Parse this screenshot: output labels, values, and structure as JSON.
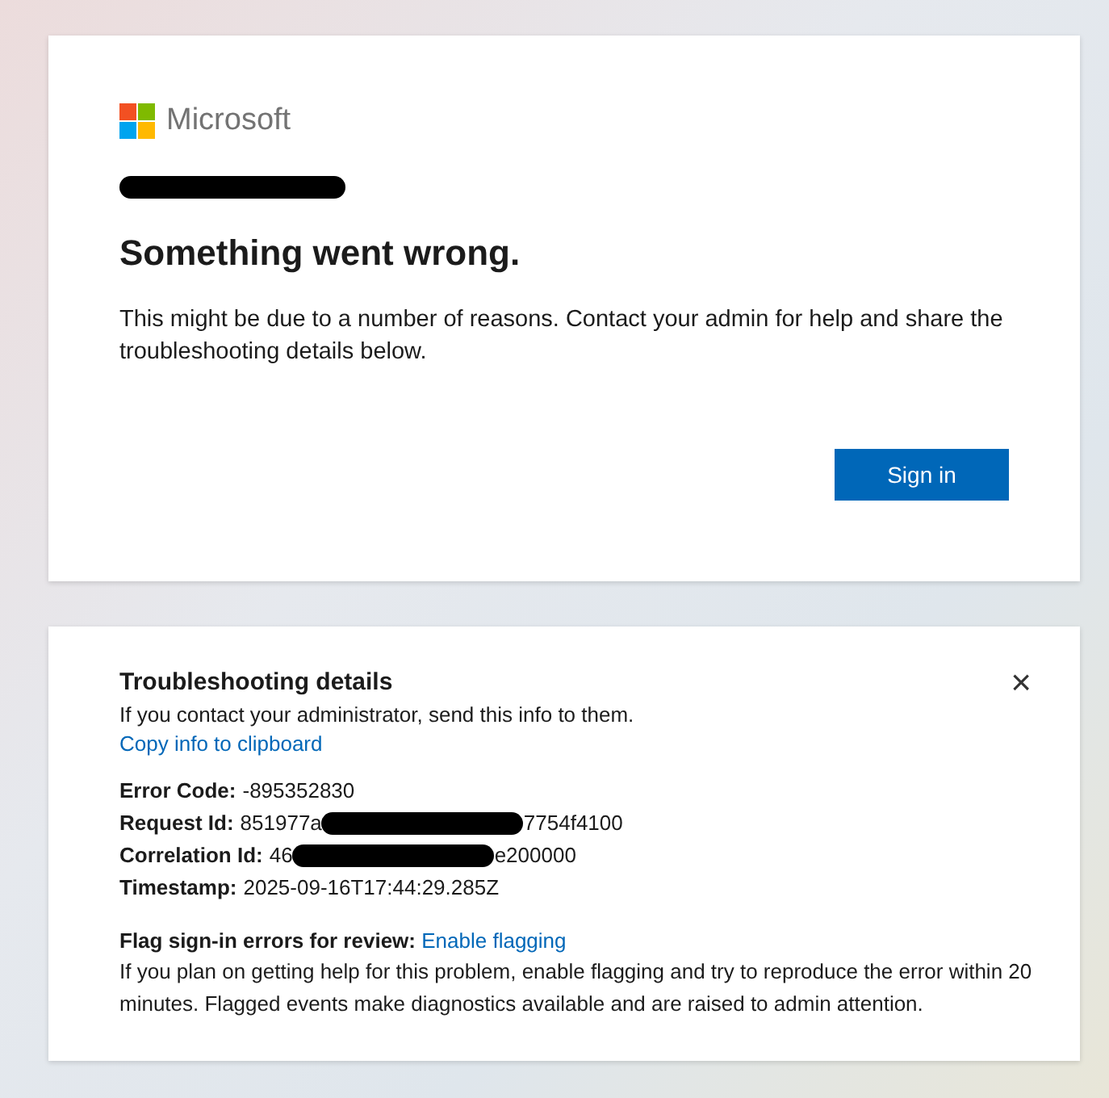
{
  "signin_card": {
    "logo": {
      "wordmark": "Microsoft"
    },
    "account": {
      "redacted": true
    },
    "title": "Something went wrong.",
    "message": "This might be due to a number of reasons. Contact your admin for help and share the troubleshooting details below.",
    "button": "Sign in"
  },
  "troubleshooting": {
    "title": "Troubleshooting details",
    "close": "×",
    "instruction": "If you contact your administrator, send this info to them.",
    "copy_link": "Copy info to clipboard",
    "details": [
      {
        "label": "Error Code:",
        "value_start": "-895352830",
        "redacted": false
      },
      {
        "label": "Request Id:",
        "value_start": "851977a",
        "redacted": true,
        "value_end": "7754f4100"
      },
      {
        "label": "Correlation Id:",
        "value_start": "46",
        "redacted": true,
        "value_end": "e200000"
      },
      {
        "label": "Timestamp:",
        "value_start": "2025-09-16T17:44:29.285Z",
        "redacted": false
      }
    ],
    "flag_label": "Flag sign-in errors for review:",
    "flag_link": "Enable flagging",
    "flag_note": "If you plan on getting help for this problem, enable flagging and try to reproduce the error within 20 minutes. Flagged events make diagnostics available and are raised to admin attention."
  }
}
